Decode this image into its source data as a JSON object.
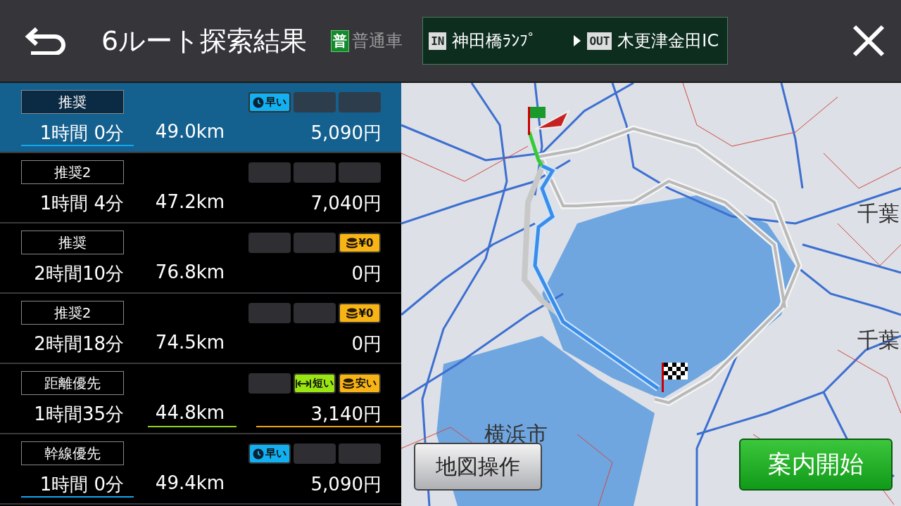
{
  "header": {
    "title": "6ルート探索結果",
    "vehicle_badge": "普",
    "vehicle": "普通車",
    "entry_tag": "IN",
    "entry": "神田橋ﾗﾝﾌﾟ",
    "exit_tag": "OUT",
    "exit": "木更津金田IC"
  },
  "routes": [
    {
      "label": "推奨",
      "time": "1時間 0分",
      "distance": "49.0km",
      "toll": "5,090円",
      "selected": true,
      "best_time": true,
      "best_distance": false,
      "best_toll": false,
      "badges": [
        {
          "kind": "fast",
          "text": "早い"
        },
        {
          "kind": "empty"
        },
        {
          "kind": "empty"
        }
      ]
    },
    {
      "label": "推奨2",
      "time": "1時間 4分",
      "distance": "47.2km",
      "toll": "7,040円",
      "selected": false,
      "best_time": false,
      "best_distance": false,
      "best_toll": false,
      "badges": [
        {
          "kind": "empty"
        },
        {
          "kind": "empty"
        },
        {
          "kind": "empty"
        }
      ]
    },
    {
      "label": "推奨",
      "time": "2時間10分",
      "distance": "76.8km",
      "toll": "0円",
      "selected": false,
      "best_time": false,
      "best_distance": false,
      "best_toll": false,
      "badges": [
        {
          "kind": "empty"
        },
        {
          "kind": "empty"
        },
        {
          "kind": "free",
          "text": "¥0"
        }
      ]
    },
    {
      "label": "推奨2",
      "time": "2時間18分",
      "distance": "74.5km",
      "toll": "0円",
      "selected": false,
      "best_time": false,
      "best_distance": false,
      "best_toll": false,
      "badges": [
        {
          "kind": "empty"
        },
        {
          "kind": "empty"
        },
        {
          "kind": "free",
          "text": "¥0"
        }
      ]
    },
    {
      "label": "距離優先",
      "time": "1時間35分",
      "distance": "44.8km",
      "toll": "3,140円",
      "selected": false,
      "best_time": false,
      "best_distance": true,
      "best_toll": true,
      "badges": [
        {
          "kind": "empty"
        },
        {
          "kind": "short",
          "text": "短い"
        },
        {
          "kind": "cheap",
          "text": "安い"
        }
      ]
    },
    {
      "label": "幹線優先",
      "time": "1時間 0分",
      "distance": "49.4km",
      "toll": "5,090円",
      "selected": false,
      "best_time": true,
      "best_distance": false,
      "best_toll": false,
      "badges": [
        {
          "kind": "fast",
          "text": "早い"
        },
        {
          "kind": "empty"
        },
        {
          "kind": "empty"
        }
      ]
    }
  ],
  "map": {
    "place_labels": [
      "千葉",
      "千葉",
      "横浜市"
    ],
    "map_control_button": "地図操作",
    "start_button": "案内開始"
  }
}
